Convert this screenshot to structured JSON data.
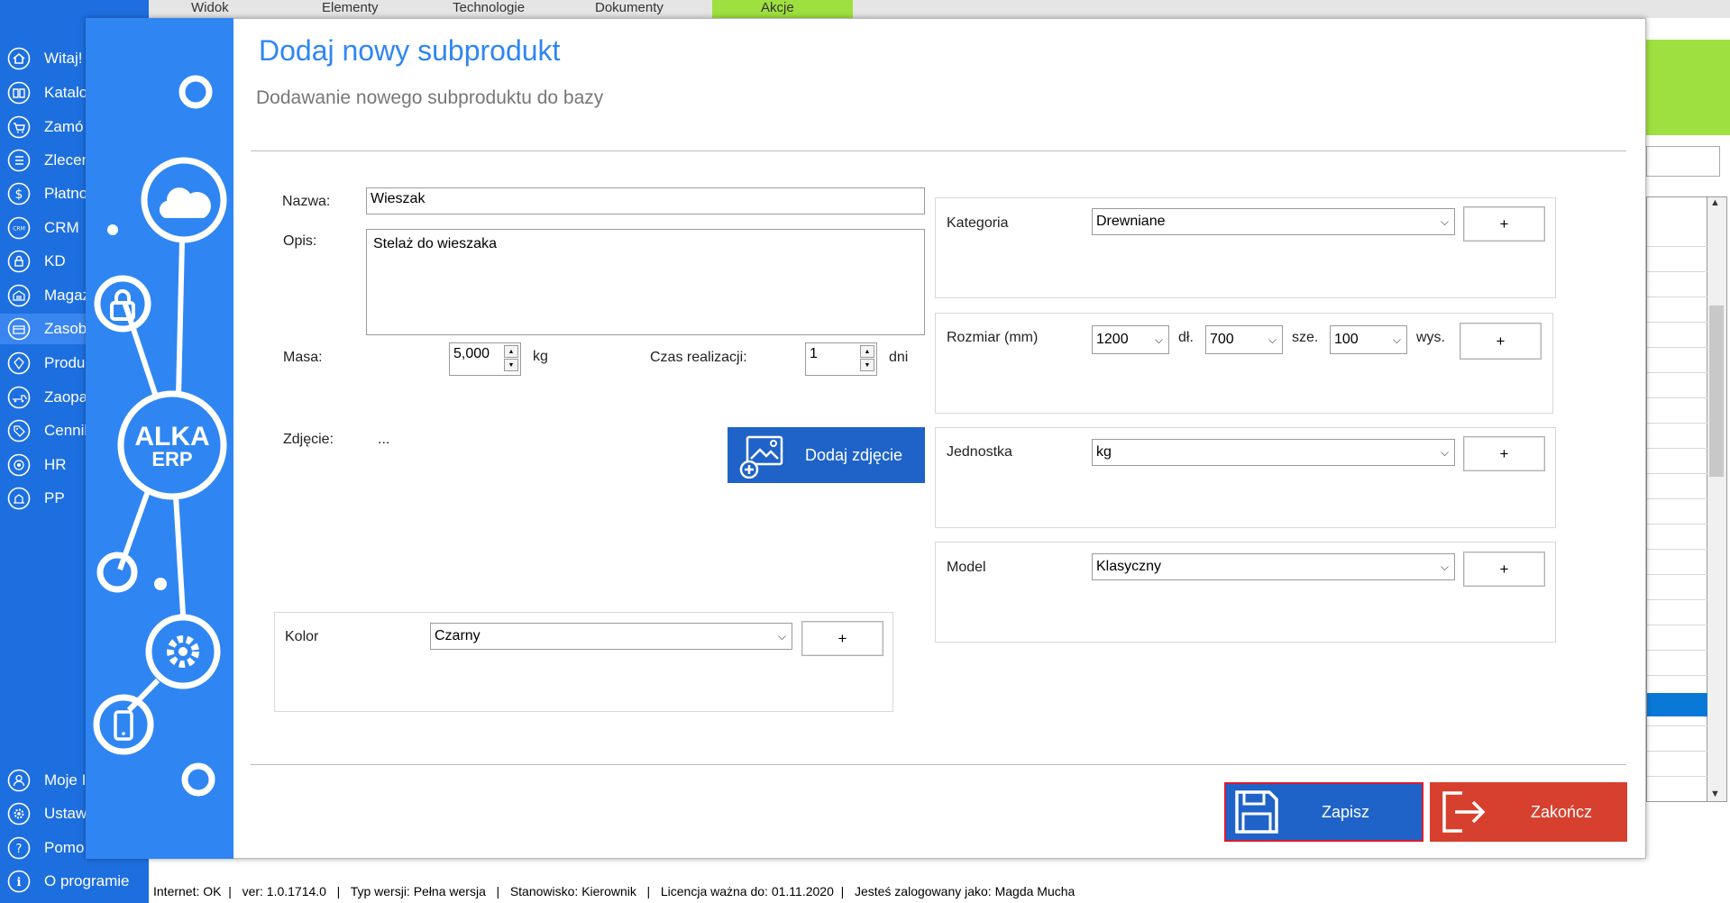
{
  "tabs": [
    "Widok",
    "Elementy",
    "Technologie",
    "Dokumenty",
    "Akcje"
  ],
  "sidebar": {
    "items": [
      {
        "label": "Witaj!",
        "icon": "home-icon"
      },
      {
        "label": "Katalo",
        "icon": "catalog-icon"
      },
      {
        "label": "Zamó",
        "icon": "cart-icon"
      },
      {
        "label": "Zlecen",
        "icon": "orders-icon"
      },
      {
        "label": "Płatno",
        "icon": "dollar-icon"
      },
      {
        "label": "CRM",
        "icon": "crm-icon"
      },
      {
        "label": "KD",
        "icon": "lock-icon"
      },
      {
        "label": "Magaz",
        "icon": "warehouse-icon"
      },
      {
        "label": "Zasob",
        "icon": "resources-icon"
      },
      {
        "label": "Produ",
        "icon": "production-icon"
      },
      {
        "label": "Zaopa",
        "icon": "supply-icon"
      },
      {
        "label": "Cennik",
        "icon": "pricetag-icon"
      },
      {
        "label": "HR",
        "icon": "hr-icon"
      },
      {
        "label": "PP",
        "icon": "pp-icon"
      }
    ],
    "bottom_items": [
      {
        "label": "Moje I",
        "icon": "user-icon"
      },
      {
        "label": "Ustawi",
        "icon": "gear-icon"
      },
      {
        "label": "Pomo",
        "icon": "help-icon"
      },
      {
        "label": "O programie",
        "icon": "info-icon"
      }
    ]
  },
  "dialog": {
    "title": "Dodaj nowy subprodukt",
    "subtitle": "Dodawanie nowego subproduktu do bazy",
    "logo_line1": "ALKA",
    "logo_line2": "ERP",
    "nazwa_label": "Nazwa:",
    "nazwa_value": "Wieszak",
    "opis_label": "Opis:",
    "opis_value": "Stelaż do wieszaka",
    "masa_label": "Masa:",
    "masa_value": "5,000",
    "masa_unit": "kg",
    "czas_label": "Czas realizacji:",
    "czas_value": "1",
    "czas_unit": "dni",
    "zdjecie_label": "Zdjęcie:",
    "zdjecie_value": "...",
    "dodaj_zdjecie": "Dodaj zdjęcie",
    "kolor_label": "Kolor",
    "kolor_value": "Czarny",
    "kategoria_label": "Kategoria",
    "kategoria_value": "Drewniane",
    "rozmiar_label": "Rozmiar (mm)",
    "rozmiar_dl": "1200",
    "rozmiar_dl_label": "dł.",
    "rozmiar_sze": "700",
    "rozmiar_sze_label": "sze.",
    "rozmiar_wys": "100",
    "rozmiar_wys_label": "wys.",
    "jednostka_label": "Jednostka",
    "jednostka_value": "kg",
    "model_label": "Model",
    "model_value": "Klasyczny",
    "plus": "+",
    "zapisz": "Zapisz",
    "zakoncz": "Zakończ"
  },
  "status_bar": {
    "text": "Internet: OK  |   ver: 1.0.1714.0   |   Typ wersji: Pełna wersja   |   Stanowisko: Kierownik   |   Licencja ważna do: 01.11.2020  |   Jesteś zalogowany jako: Magda Mucha"
  },
  "colors": {
    "sidebar": "#1d6fe0",
    "dialog_art": "#2f86f2",
    "accent_green": "#9ee040",
    "save_button": "#1f63c9",
    "close_button": "#d7402e",
    "title": "#2f86f2"
  }
}
